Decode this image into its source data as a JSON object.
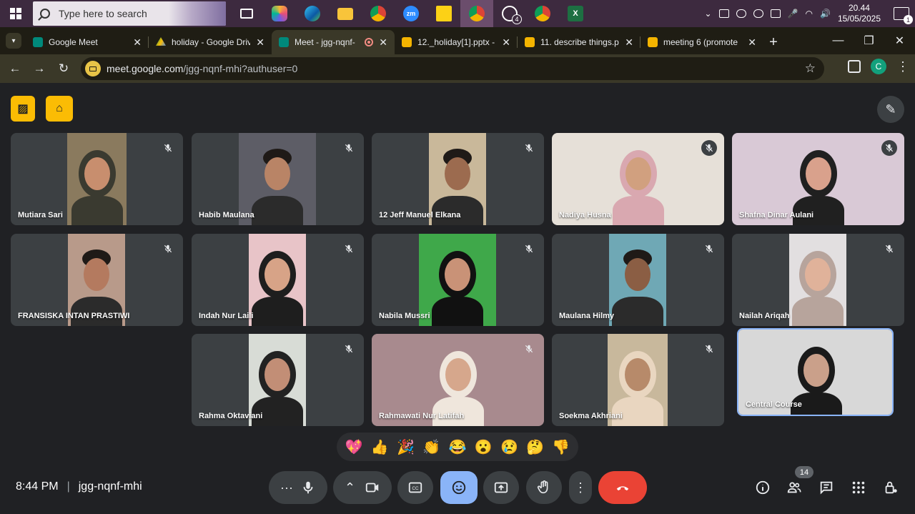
{
  "taskbar": {
    "search_placeholder": "Type here to search",
    "time": "20.44",
    "date": "15/05/2025",
    "notification_count": "1",
    "whatsapp_badge": "4"
  },
  "browser": {
    "tabs": [
      {
        "title": "Google Meet",
        "favicon": "meet-icon",
        "color": "#00897b"
      },
      {
        "title": "holiday - Google Driv",
        "favicon": "drive-icon",
        "color": "#fbbc04"
      },
      {
        "title": "Meet - jgg-nqnf-",
        "favicon": "meet-icon",
        "color": "#00897b"
      },
      {
        "title": "12._holiday[1].pptx - ",
        "favicon": "slides-icon",
        "color": "#f4b400"
      },
      {
        "title": "11. describe things.pp",
        "favicon": "slides-icon",
        "color": "#f4b400"
      },
      {
        "title": "meeting 6 (promote ",
        "favicon": "slides-icon",
        "color": "#f4b400"
      }
    ],
    "url_host": "meet.google.com",
    "url_path": "/jgg-nqnf-mhi?authuser=0",
    "profile_initial": "C"
  },
  "meet": {
    "clock": "8:44 PM",
    "meeting_code": "jgg-nqnf-mhi",
    "participant_count": "14",
    "reactions": [
      "💖",
      "👍",
      "🎉",
      "👏",
      "😂",
      "😮",
      "😢",
      "🤔",
      "👎"
    ],
    "participants": [
      {
        "name": "Mutiara Sari",
        "bg": "#8a7a5e"
      },
      {
        "name": "Habib Maulana",
        "bg": "#5d5d66"
      },
      {
        "name": "12 Jeff Manuel Elkana",
        "bg": "#c9b89a"
      },
      {
        "name": "Nadiya Husna",
        "bg": "#e6e0d8"
      },
      {
        "name": "Shafna Dinar Aulani",
        "bg": "#d9c9d6"
      },
      {
        "name": "FRANSISKA INTAN PRASTIWI",
        "bg": "#b89a8a"
      },
      {
        "name": "Indah Nur Laili",
        "bg": "#e8c4c8"
      },
      {
        "name": "Nabila Mussri",
        "bg": "#3fa84a"
      },
      {
        "name": "Maulana Hilmy",
        "bg": "#6fa8b5"
      },
      {
        "name": "Nailah Ariqah",
        "bg": "#e2dfe0"
      },
      {
        "name": "Rahma Oktaviani",
        "bg": "#d8dcd6"
      },
      {
        "name": "Rahmawati Nur Latifah",
        "bg": "#a88a8e"
      },
      {
        "name": "Soekma Akhriani",
        "bg": "#c8b89c"
      },
      {
        "name": "Central Course",
        "bg": "#d8d8d8"
      }
    ]
  }
}
